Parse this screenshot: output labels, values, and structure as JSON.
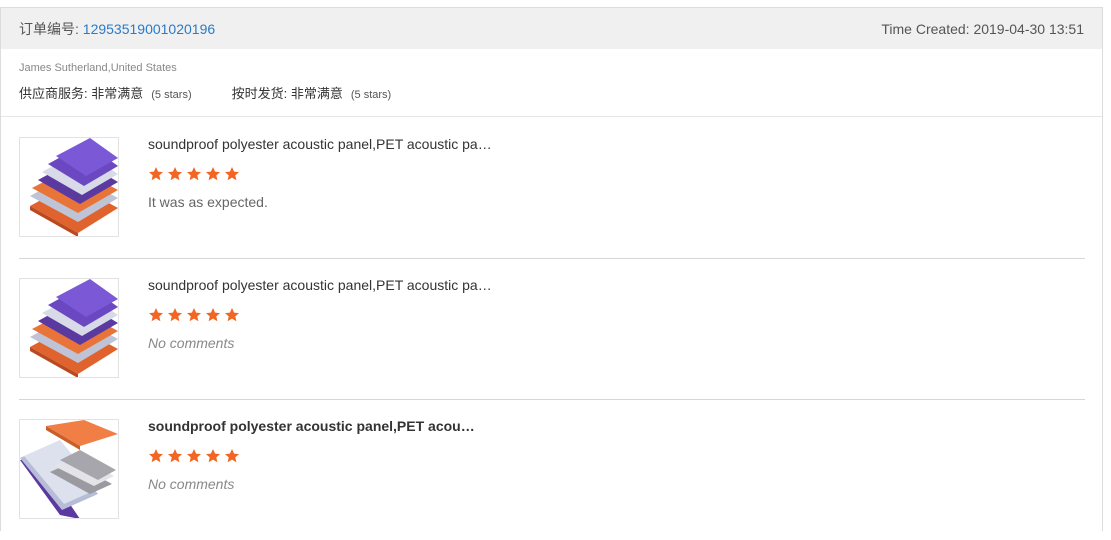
{
  "order": {
    "label": "订单编号:",
    "id": "12953519001020196",
    "time_label": "Time Created:",
    "time_value": "2019-04-30 13:51"
  },
  "buyer": {
    "name": "James Sutherland,United States",
    "ratings": [
      {
        "label": "供应商服务:",
        "value": "非常满意",
        "stars": "(5 stars)"
      },
      {
        "label": "按时发货:",
        "value": "非常满意",
        "stars": "(5 stars)"
      }
    ]
  },
  "items": [
    {
      "title": "soundproof polyester acoustic panel,PET acoustic pa…",
      "rating": 5,
      "comment": "It was as expected.",
      "image": "acoustic-panel-stack-purple-orange"
    },
    {
      "title": "soundproof polyester acoustic panel,PET acoustic pa…",
      "rating": 5,
      "comment": "No comments",
      "image": "acoustic-panel-stack-purple-orange"
    },
    {
      "title": "soundproof polyester acoustic panel,PET acou…",
      "rating": 5,
      "comment": "No comments",
      "image": "acoustic-panel-stack-orange-purple"
    }
  ],
  "colors": {
    "star": "#f26522",
    "link": "#2a7bc8",
    "header_bg": "#f0f0f0"
  }
}
